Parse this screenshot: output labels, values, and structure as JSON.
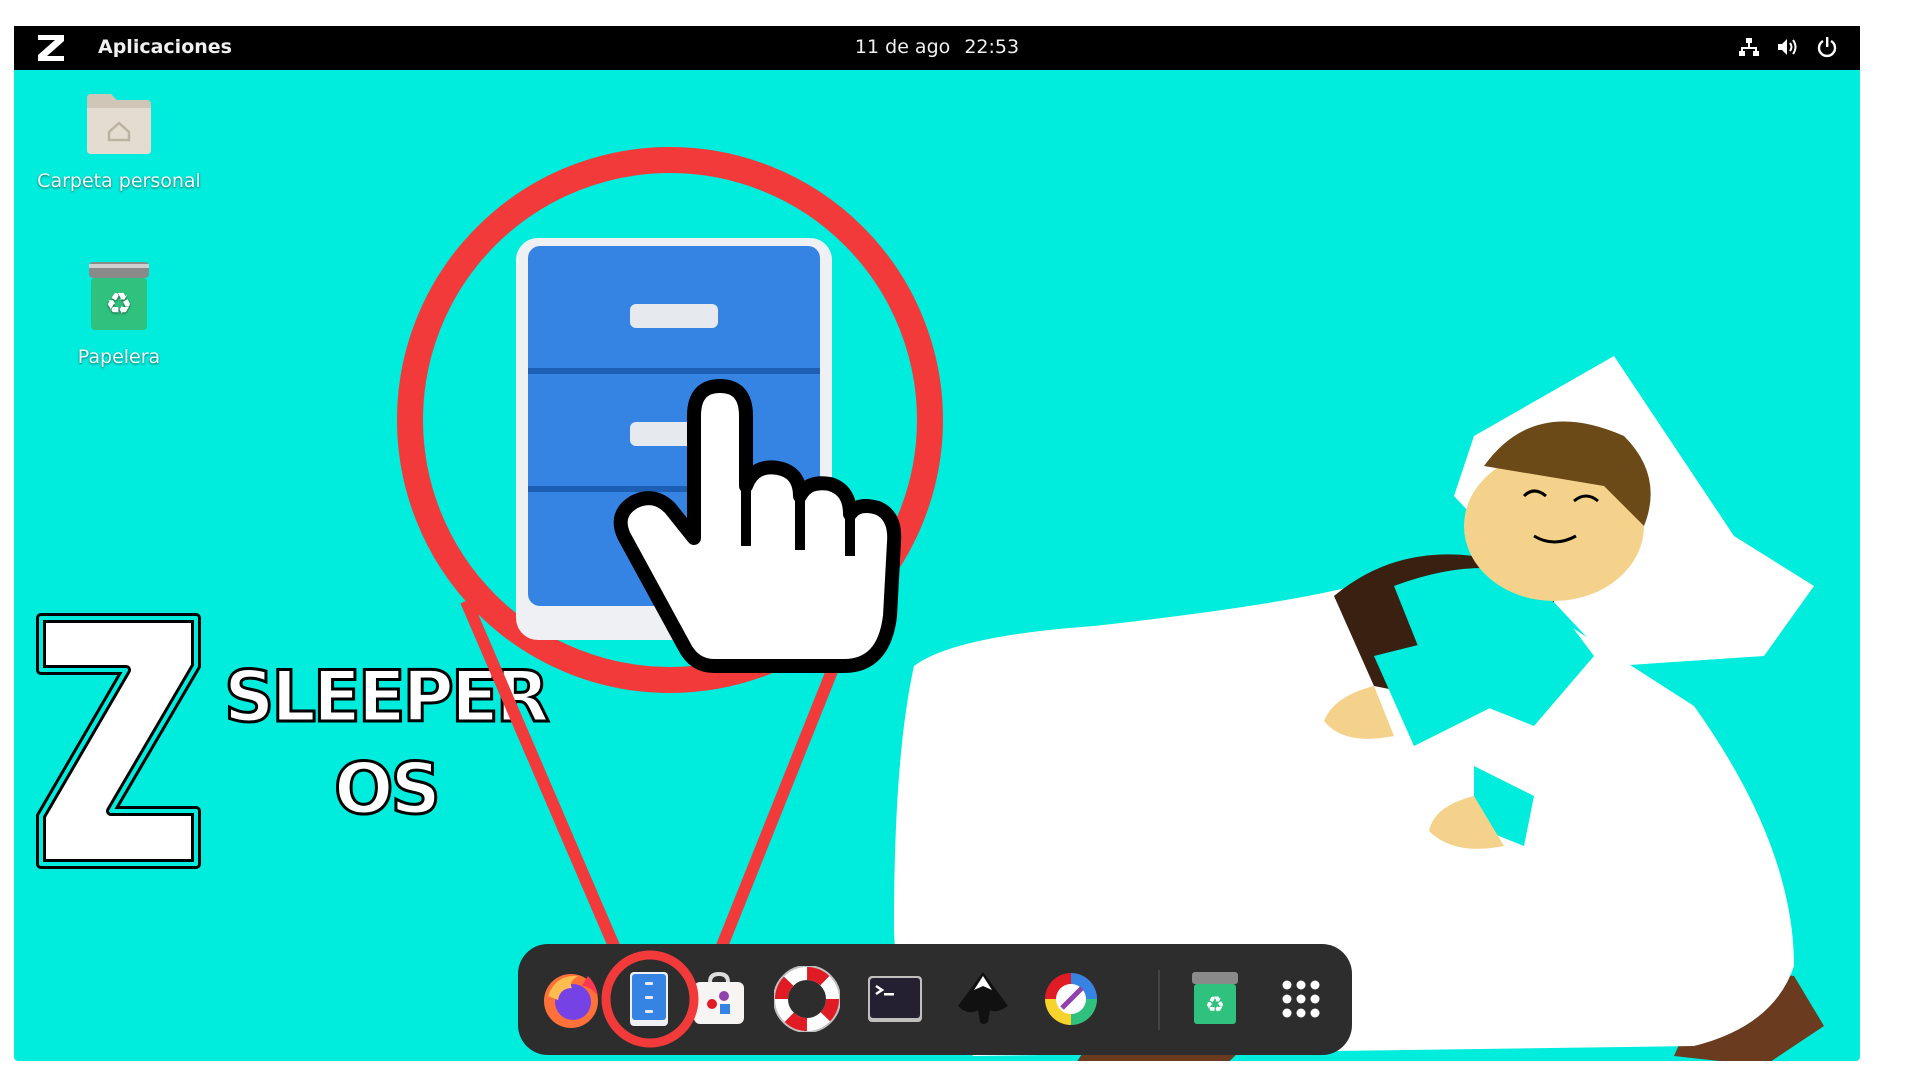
{
  "topbar": {
    "logo": "Z",
    "apps_label": "Aplicaciones",
    "date": "11 de ago",
    "time": "22:53",
    "tray_icons": [
      "network-icon",
      "volume-icon",
      "power-icon"
    ]
  },
  "desktop": {
    "icons": [
      {
        "label": "Carpeta personal",
        "icon": "home-folder-icon"
      },
      {
        "label": "Papelera",
        "icon": "trash-icon"
      }
    ],
    "wallpaper": {
      "brand_letter": "Z",
      "brand_line1": "SLEEPER",
      "brand_line2": "OS",
      "background_color": "#00ecdc"
    }
  },
  "dock": {
    "items": [
      {
        "name": "firefox",
        "icon": "firefox-icon"
      },
      {
        "name": "files",
        "icon": "file-cabinet-icon",
        "highlighted": true
      },
      {
        "name": "software",
        "icon": "software-store-icon"
      },
      {
        "name": "help",
        "icon": "lifebuoy-icon"
      },
      {
        "name": "terminal",
        "icon": "terminal-icon"
      },
      {
        "name": "inkscape",
        "icon": "inkscape-icon"
      },
      {
        "name": "color-picker",
        "icon": "color-wheel-icon"
      },
      {
        "name": "trash",
        "icon": "trash-icon"
      },
      {
        "name": "app-grid",
        "icon": "app-grid-icon"
      }
    ]
  },
  "annotation": {
    "color": "#f23a3a",
    "pointer_icon": "hand-pointer-icon",
    "magnified_icon": "file-cabinet-icon"
  }
}
